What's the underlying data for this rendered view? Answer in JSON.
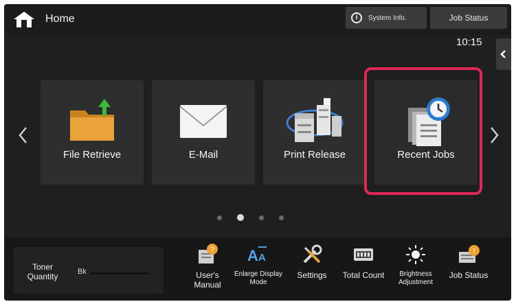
{
  "header": {
    "home_label": "Home",
    "system_info_label": "System Info.",
    "job_status_label": "Job Status",
    "clock": "10:15"
  },
  "tiles": [
    {
      "label": "File Retrieve",
      "icon": "folder-upload-icon"
    },
    {
      "label": "E-Mail",
      "icon": "envelope-icon"
    },
    {
      "label": "Print Release",
      "icon": "network-printers-icon"
    },
    {
      "label": "Recent Jobs",
      "icon": "recent-jobs-clock-icon"
    }
  ],
  "pager": {
    "pages": 4,
    "current": 2
  },
  "bottom": {
    "toner": {
      "label": "Toner Quantity",
      "color": "Bk"
    },
    "items": [
      {
        "label": "User's Manual",
        "icon": "manual-help-icon"
      },
      {
        "label": "Enlarge Display Mode",
        "icon": "enlarge-text-icon"
      },
      {
        "label": "Settings",
        "icon": "wrench-screwdriver-icon"
      },
      {
        "label": "Total Count",
        "icon": "counter-icon"
      },
      {
        "label": "Brightness Adjustment",
        "icon": "brightness-icon"
      },
      {
        "label": "Job Status",
        "icon": "job-status-icon"
      }
    ]
  },
  "colors": {
    "background": "#1f1f1f",
    "tile": "#2e2e2e",
    "selection": "#e02757",
    "folder": "#e9a33a",
    "upload_arrow": "#3dbb3d",
    "badge": "#f0a030"
  }
}
